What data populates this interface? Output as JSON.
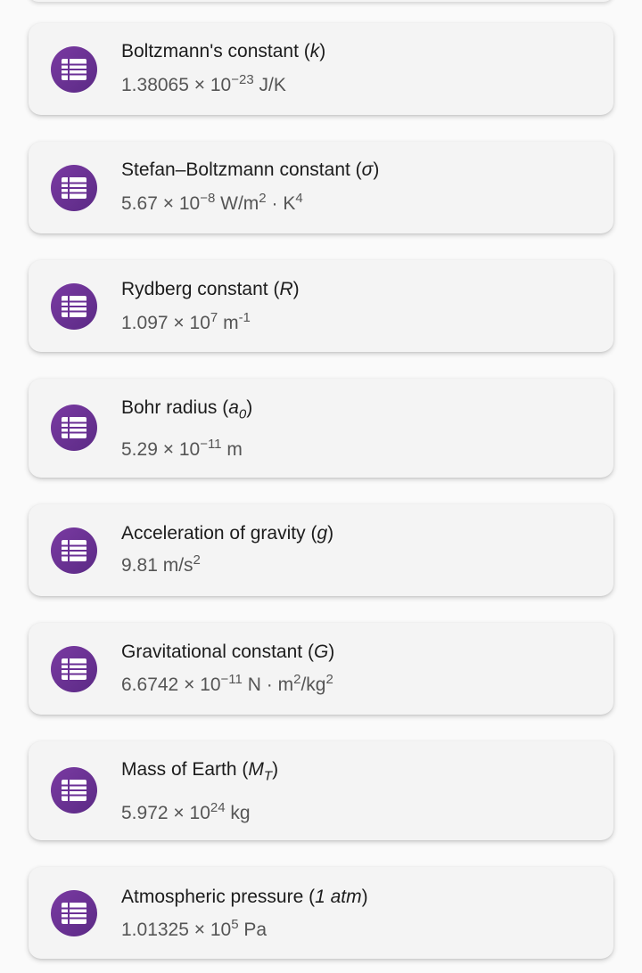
{
  "constants": [
    {
      "name": "Boltzmann's constant",
      "symbol": "k",
      "value": {
        "mantissa": "1.38065",
        "times": "×",
        "base": "10",
        "exponent": "−23",
        "unit": "J/K"
      }
    },
    {
      "name": "Stefan–Boltzmann constant",
      "symbol": "σ",
      "value": {
        "mantissa": "5.67",
        "times": "×",
        "base": "10",
        "exponent": "−8",
        "unit_a": "W/m",
        "unit_a_exp": "2",
        "unit_sep": "·",
        "unit_b": "K",
        "unit_b_exp": "4"
      }
    },
    {
      "name": "Rydberg constant",
      "symbol": "R",
      "value": {
        "mantissa": "1.097",
        "times": "×",
        "base": "10",
        "exponent": "7",
        "unit": "m",
        "unit_exp": "-1"
      }
    },
    {
      "name": "Bohr radius",
      "symbol_base": "a",
      "symbol_sub": "0",
      "value": {
        "mantissa": "5.29",
        "times": "×",
        "base": "10",
        "exponent": "−11",
        "unit": "m"
      }
    },
    {
      "name": "Acceleration of gravity",
      "symbol": "g",
      "value": {
        "text": "9.81 m/s",
        "exp": "2"
      }
    },
    {
      "name": "Gravitational constant",
      "symbol": "G",
      "value": {
        "mantissa": "6.6742",
        "times": "×",
        "base": "10",
        "exponent": "−11",
        "unit_a": "N",
        "unit_sep": "·",
        "unit_b": "m",
        "unit_b_exp": "2",
        "unit_c": "/kg",
        "unit_c_exp": "2"
      }
    },
    {
      "name": "Mass of Earth",
      "symbol_base": "M",
      "symbol_sub": "T",
      "value": {
        "mantissa": "5.972",
        "times": "×",
        "base": "10",
        "exponent": "24",
        "unit": "kg"
      }
    },
    {
      "name": "Atmospheric pressure",
      "symbol": "1 atm",
      "value": {
        "mantissa": "1.01325",
        "times": "×",
        "base": "10",
        "exponent": "5",
        "unit": "Pa"
      }
    }
  ],
  "icon": "list-icon",
  "colors": {
    "background": "#fafafa",
    "card": "#f4f4f4",
    "icon_circle": "#6a2f95",
    "title_text": "#1c1c1c",
    "value_text": "#555555"
  }
}
